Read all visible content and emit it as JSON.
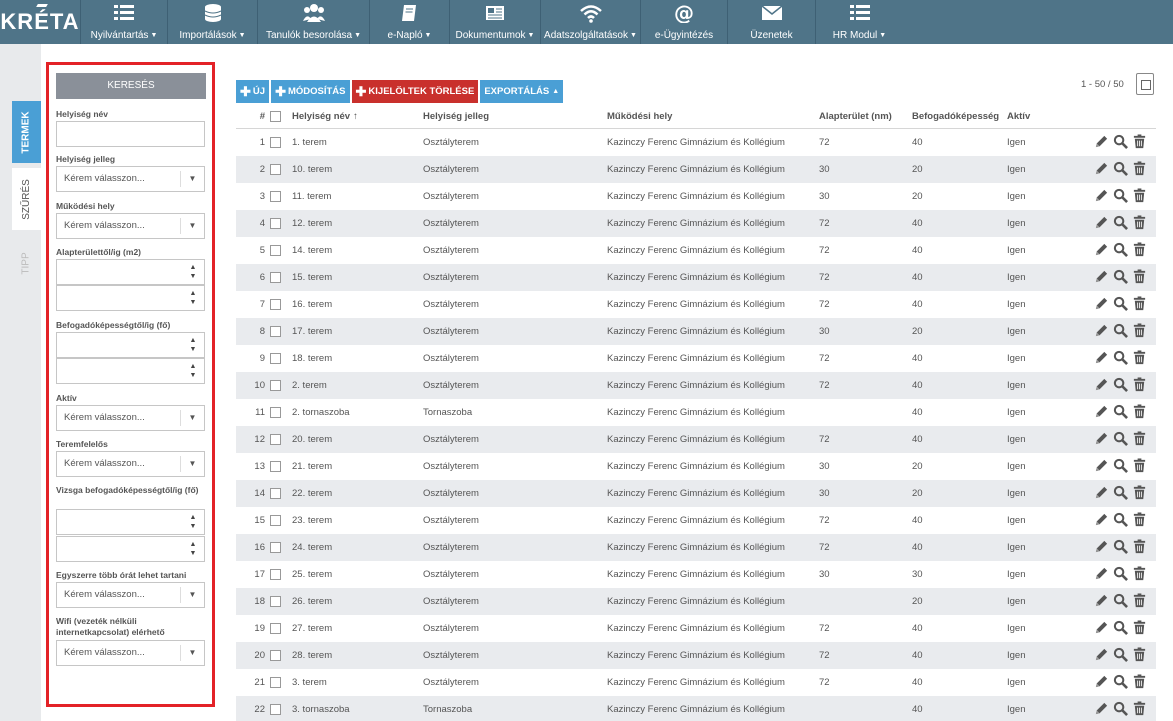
{
  "app": {
    "logo": "KRÉTA"
  },
  "nav": [
    {
      "label": "Nyilvántartás",
      "icon": "list-icon",
      "caret": true,
      "w": 87
    },
    {
      "label": "Importálások",
      "icon": "database-icon",
      "caret": true,
      "w": 90
    },
    {
      "label": "Tanulók besorolása",
      "icon": "users-icon",
      "caret": true,
      "w": 112
    },
    {
      "label": "e-Napló",
      "icon": "book-icon",
      "caret": true,
      "w": 80
    },
    {
      "label": "Dokumentumok",
      "icon": "newspaper-icon",
      "caret": true,
      "w": 91
    },
    {
      "label": "Adatszolgáltatások",
      "icon": "wifi-icon",
      "caret": true,
      "w": 100
    },
    {
      "label": "e-Ügyintézés",
      "icon": "at-icon",
      "caret": false,
      "w": 87
    },
    {
      "label": "Üzenetek",
      "icon": "envelope-icon",
      "caret": false,
      "w": 88
    },
    {
      "label": "HR Modul",
      "icon": "list-icon",
      "caret": true,
      "w": 88
    }
  ],
  "side_tabs": {
    "termek": "TERMEK",
    "szures": "SZŰRÉS",
    "tipp": "TIPP"
  },
  "filter": {
    "search_button": "KERESÉS",
    "placeholder": "Kérem válasszon...",
    "fields": {
      "helyiseg_nev": "Helyiség név",
      "helyiseg_jelleg": "Helyiség jelleg",
      "mukodesi_hely": "Működési hely",
      "alapterulet": "Alapterülettől/ig (m2)",
      "befogadokepesseg": "Befogadóképességtől/ig (fő)",
      "aktiv": "Aktív",
      "teremfelelos": "Teremfelelős",
      "vizsga": "Vizsga befogadóképességtől/ig (fő)",
      "egyszerre": "Egyszerre több órát lehet tartani",
      "wifi": "Wifi (vezeték nélküli internetkapcsolat) elérhető"
    }
  },
  "toolbar": {
    "new": "ÚJ",
    "modify": "MÓDOSÍTÁS",
    "delete_selected": "KIJELÖLTEK TÖRLÉSE",
    "export": "EXPORTÁLÁS"
  },
  "pager": "1 - 50 / 50",
  "table": {
    "headers": {
      "num": "#",
      "name": "Helyiség név",
      "jelleg": "Helyiség jelleg",
      "hely": "Működési hely",
      "terulet": "Alapterület (nm)",
      "befogado": "Befogadóképesség",
      "aktiv": "Aktív"
    },
    "rows": [
      {
        "n": "1",
        "name": "1. terem",
        "jelleg": "Osztályterem",
        "hely": "Kazinczy Ferenc Gimnázium és Kollégium",
        "terulet": "72",
        "befogado": "40",
        "aktiv": "Igen"
      },
      {
        "n": "2",
        "name": "10. terem",
        "jelleg": "Osztályterem",
        "hely": "Kazinczy Ferenc Gimnázium és Kollégium",
        "terulet": "30",
        "befogado": "20",
        "aktiv": "Igen"
      },
      {
        "n": "3",
        "name": "11. terem",
        "jelleg": "Osztályterem",
        "hely": "Kazinczy Ferenc Gimnázium és Kollégium",
        "terulet": "30",
        "befogado": "20",
        "aktiv": "Igen"
      },
      {
        "n": "4",
        "name": "12. terem",
        "jelleg": "Osztályterem",
        "hely": "Kazinczy Ferenc Gimnázium és Kollégium",
        "terulet": "72",
        "befogado": "40",
        "aktiv": "Igen"
      },
      {
        "n": "5",
        "name": "14. terem",
        "jelleg": "Osztályterem",
        "hely": "Kazinczy Ferenc Gimnázium és Kollégium",
        "terulet": "72",
        "befogado": "40",
        "aktiv": "Igen"
      },
      {
        "n": "6",
        "name": "15. terem",
        "jelleg": "Osztályterem",
        "hely": "Kazinczy Ferenc Gimnázium és Kollégium",
        "terulet": "72",
        "befogado": "40",
        "aktiv": "Igen"
      },
      {
        "n": "7",
        "name": "16. terem",
        "jelleg": "Osztályterem",
        "hely": "Kazinczy Ferenc Gimnázium és Kollégium",
        "terulet": "72",
        "befogado": "40",
        "aktiv": "Igen"
      },
      {
        "n": "8",
        "name": "17. terem",
        "jelleg": "Osztályterem",
        "hely": "Kazinczy Ferenc Gimnázium és Kollégium",
        "terulet": "30",
        "befogado": "20",
        "aktiv": "Igen"
      },
      {
        "n": "9",
        "name": "18. terem",
        "jelleg": "Osztályterem",
        "hely": "Kazinczy Ferenc Gimnázium és Kollégium",
        "terulet": "72",
        "befogado": "40",
        "aktiv": "Igen"
      },
      {
        "n": "10",
        "name": "2. terem",
        "jelleg": "Osztályterem",
        "hely": "Kazinczy Ferenc Gimnázium és Kollégium",
        "terulet": "72",
        "befogado": "40",
        "aktiv": "Igen"
      },
      {
        "n": "11",
        "name": "2. tornaszoba",
        "jelleg": "Tornaszoba",
        "hely": "Kazinczy Ferenc Gimnázium és Kollégium",
        "terulet": "",
        "befogado": "40",
        "aktiv": "Igen"
      },
      {
        "n": "12",
        "name": "20. terem",
        "jelleg": "Osztályterem",
        "hely": "Kazinczy Ferenc Gimnázium és Kollégium",
        "terulet": "72",
        "befogado": "40",
        "aktiv": "Igen"
      },
      {
        "n": "13",
        "name": "21. terem",
        "jelleg": "Osztályterem",
        "hely": "Kazinczy Ferenc Gimnázium és Kollégium",
        "terulet": "30",
        "befogado": "20",
        "aktiv": "Igen"
      },
      {
        "n": "14",
        "name": "22. terem",
        "jelleg": "Osztályterem",
        "hely": "Kazinczy Ferenc Gimnázium és Kollégium",
        "terulet": "30",
        "befogado": "20",
        "aktiv": "Igen"
      },
      {
        "n": "15",
        "name": "23. terem",
        "jelleg": "Osztályterem",
        "hely": "Kazinczy Ferenc Gimnázium és Kollégium",
        "terulet": "72",
        "befogado": "40",
        "aktiv": "Igen"
      },
      {
        "n": "16",
        "name": "24. terem",
        "jelleg": "Osztályterem",
        "hely": "Kazinczy Ferenc Gimnázium és Kollégium",
        "terulet": "72",
        "befogado": "40",
        "aktiv": "Igen"
      },
      {
        "n": "17",
        "name": "25. terem",
        "jelleg": "Osztályterem",
        "hely": "Kazinczy Ferenc Gimnázium és Kollégium",
        "terulet": "30",
        "befogado": "30",
        "aktiv": "Igen"
      },
      {
        "n": "18",
        "name": "26. terem",
        "jelleg": "Osztályterem",
        "hely": "Kazinczy Ferenc Gimnázium és Kollégium",
        "terulet": "",
        "befogado": "20",
        "aktiv": "Igen"
      },
      {
        "n": "19",
        "name": "27. terem",
        "jelleg": "Osztályterem",
        "hely": "Kazinczy Ferenc Gimnázium és Kollégium",
        "terulet": "72",
        "befogado": "40",
        "aktiv": "Igen"
      },
      {
        "n": "20",
        "name": "28. terem",
        "jelleg": "Osztályterem",
        "hely": "Kazinczy Ferenc Gimnázium és Kollégium",
        "terulet": "72",
        "befogado": "40",
        "aktiv": "Igen"
      },
      {
        "n": "21",
        "name": "3. terem",
        "jelleg": "Osztályterem",
        "hely": "Kazinczy Ferenc Gimnázium és Kollégium",
        "terulet": "72",
        "befogado": "40",
        "aktiv": "Igen"
      },
      {
        "n": "22",
        "name": "3. tornaszoba",
        "jelleg": "Tornaszoba",
        "hely": "Kazinczy Ferenc Gimnázium és Kollégium",
        "terulet": "",
        "befogado": "40",
        "aktiv": "Igen"
      }
    ]
  },
  "colors": {
    "topbar": "#4f7488",
    "accent_blue": "#4a9fd5",
    "danger_red": "#c9302c",
    "highlight_border": "#e32227",
    "row_alt": "#e9ebee"
  }
}
